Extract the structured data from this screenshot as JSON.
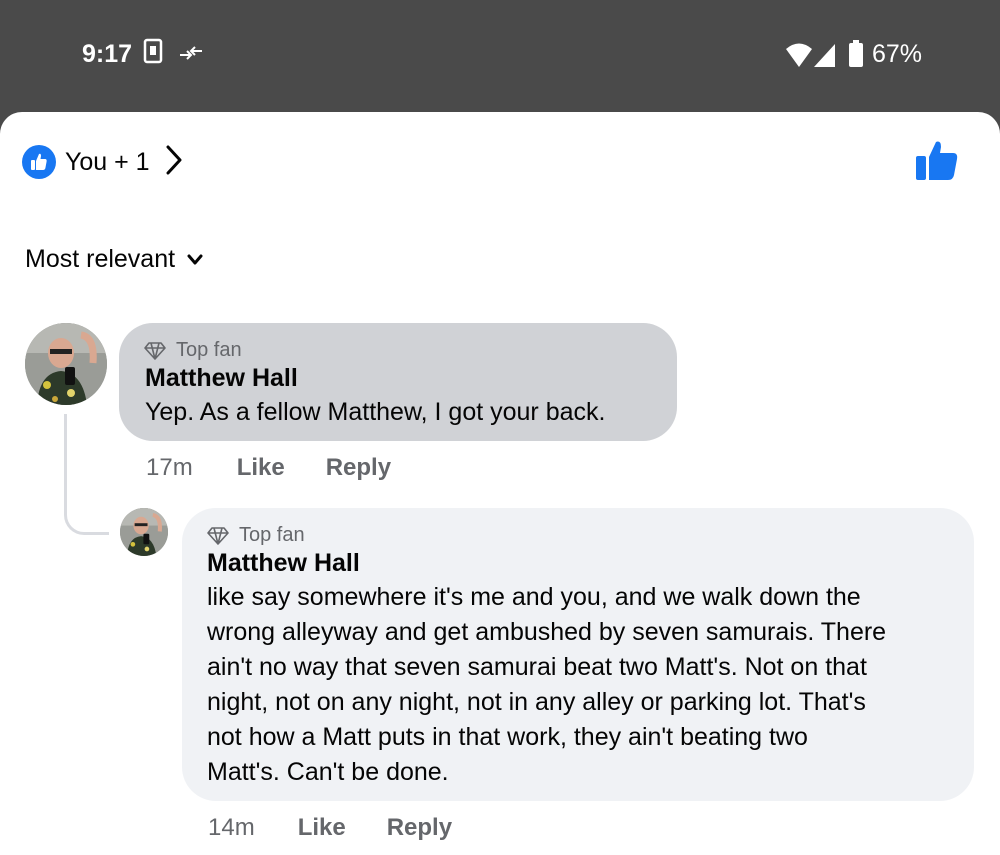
{
  "status_bar": {
    "time": "9:17",
    "battery_percent": "67%",
    "icons": [
      "notification-card-icon",
      "data-arrows-icon",
      "wifi-icon",
      "cell-signal-icon",
      "battery-icon"
    ]
  },
  "reactions": {
    "summary": "You + 1",
    "badge_icon": "thumbs-up-icon",
    "like_button_icon": "thumbs-up-icon"
  },
  "sort": {
    "label": "Most relevant",
    "icon": "chevron-down-icon"
  },
  "comments": [
    {
      "badge": "Top fan",
      "author": "Matthew Hall",
      "text": "Yep. As a fellow Matthew, I got your back.",
      "time": "17m",
      "like_label": "Like",
      "reply_label": "Reply"
    },
    {
      "badge": "Top fan",
      "author": "Matthew Hall",
      "text_lines": [
        "like say somewhere it's me and you, and we walk down the",
        "wrong alleyway and get ambushed by seven samurais. There",
        "ain't no way that seven samurai beat two Matt's. Not on that",
        "night, not on any night, not in any alley or parking lot. That's",
        "not how a Matt puts in that work, they ain't beating two",
        "Matt's. Can't be done."
      ],
      "time": "14m",
      "like_label": "Like",
      "reply_label": "Reply"
    }
  ],
  "colors": {
    "accent": "#1877f2",
    "bubble_dark": "#d0d2d6",
    "bubble_light": "#f0f2f5",
    "status_bar": "#4a4a4a",
    "secondary_text": "#65676b"
  }
}
